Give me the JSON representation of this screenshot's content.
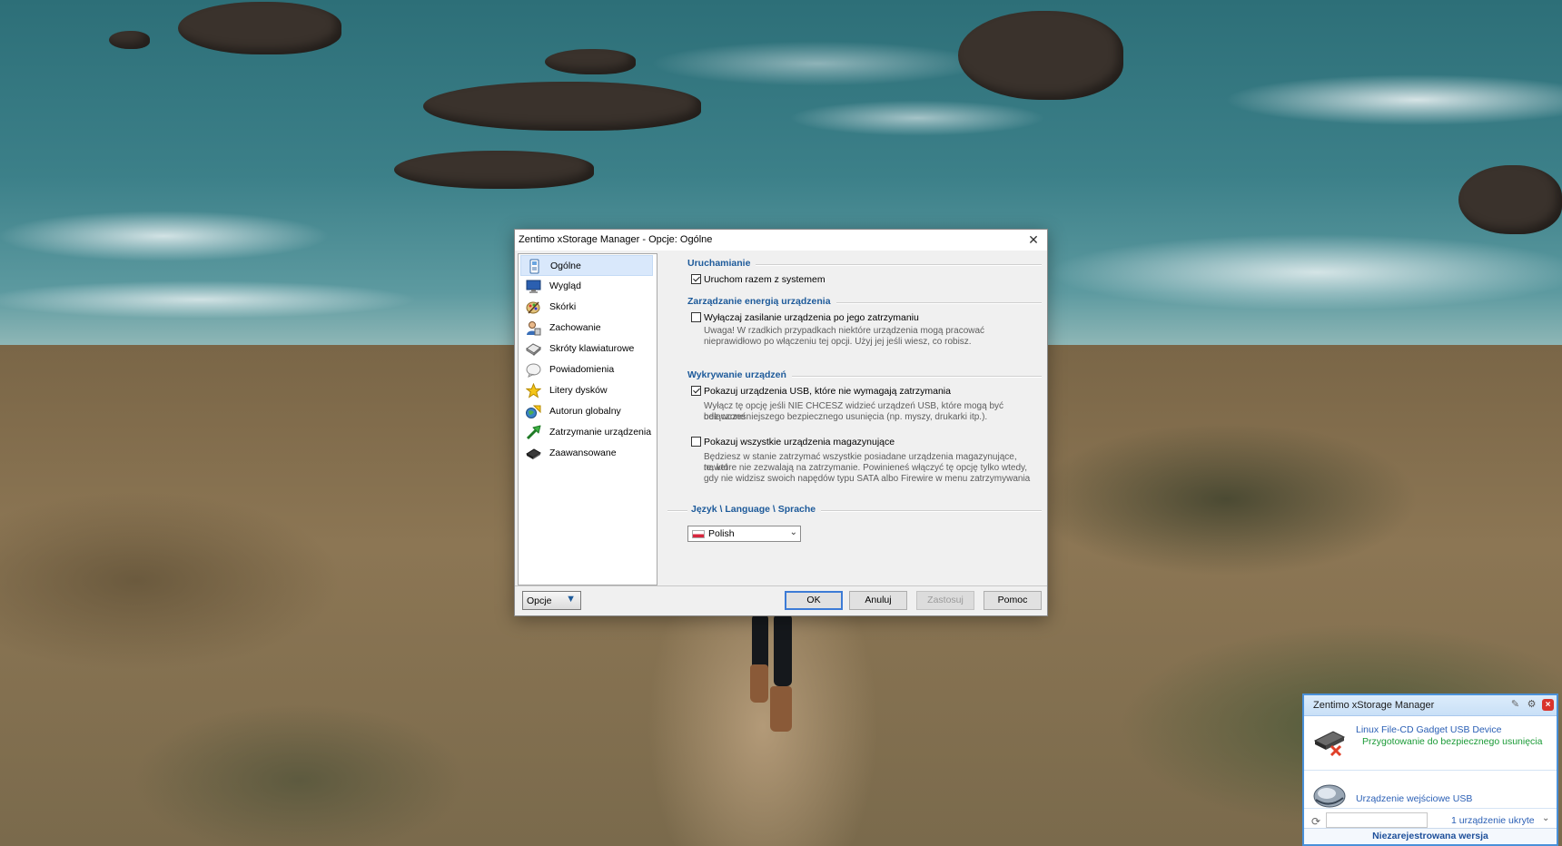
{
  "dialog": {
    "title": "Zentimo xStorage Manager - Opcje: Ogólne",
    "close_glyph": "✕",
    "nav": [
      {
        "label": "Ogólne",
        "icon": "general-settings-icon",
        "selected": true
      },
      {
        "label": "Wygląd",
        "icon": "appearance-monitor-icon"
      },
      {
        "label": "Skórki",
        "icon": "skins-brush-icon"
      },
      {
        "label": "Zachowanie",
        "icon": "behavior-user-icon"
      },
      {
        "label": "Skróty klawiaturowe",
        "icon": "keyboard-shortcuts-icon"
      },
      {
        "label": "Powiadomienia",
        "icon": "notifications-icon"
      },
      {
        "label": "Litery dysków",
        "icon": "drive-letters-star-icon"
      },
      {
        "label": "Autorun globalny",
        "icon": "global-autorun-icon"
      },
      {
        "label": "Zatrzymanie urządzenia",
        "icon": "device-stop-arrow-icon"
      },
      {
        "label": "Zaawansowane",
        "icon": "advanced-chip-icon"
      }
    ],
    "sections": {
      "startup": {
        "title": "Uruchamianie",
        "start_with_system": {
          "label": "Uruchom razem z systemem",
          "checked": true
        }
      },
      "power": {
        "title": "Zarządzanie energią urządzenia",
        "power_off": {
          "label": "Wyłączaj zasilanie urządzenia po jego zatrzymaniu",
          "checked": false
        },
        "note_line1": "Uwaga! W rzadkich przypadkach niektóre urządzenia mogą pracować",
        "note_line2": "nieprawidłowo po włączeniu tej opcji. Użyj jej jeśli wiesz, co robisz."
      },
      "detection": {
        "title": "Wykrywanie urządzeń",
        "show_usb": {
          "label": "Pokazuj urządzenia USB, które nie wymagają zatrzymania",
          "checked": true
        },
        "usb_note_line1": "Wyłącz tę opcję jeśli NIE CHCESZ widzieć urządzeń USB, które mogą być odłączone",
        "usb_note_line2": "bez wcześniejszego bezpiecznego usunięcia (np. myszy, drukarki itp.).",
        "show_all": {
          "label": "Pokazuj wszystkie urządzenia magazynujące",
          "checked": false
        },
        "all_note_line1": "Będziesz w stanie zatrzymać wszystkie posiadane urządzenia magazynujące, nawet",
        "all_note_line2": "te, które nie zezwalają na zatrzymanie. Powinieneś włączyć tę opcję tylko wtedy,",
        "all_note_line3": "gdy nie widzisz swoich napędów typu SATA albo Firewire w menu zatrzymywania"
      },
      "language": {
        "title": "Język \\ Language \\ Sprache",
        "selected": "Polish"
      }
    },
    "footer": {
      "options_label": "Opcje",
      "ok": "OK",
      "cancel": "Anuluj",
      "apply": "Zastosuj",
      "help": "Pomoc"
    }
  },
  "panel": {
    "title": "Zentimo xStorage Manager",
    "devices": [
      {
        "name": "Linux File-CD Gadget USB Device",
        "status": "Przygotowanie do bezpiecznego usunięcia",
        "icon": "usb-drive-removing-icon"
      },
      {
        "name": "Urządzenie wejściowe USB",
        "icon": "usb-mouse-icon"
      }
    ],
    "hidden_count": "1 urządzenie ukryte",
    "unregistered": "Niezarejestrowana wersja"
  }
}
